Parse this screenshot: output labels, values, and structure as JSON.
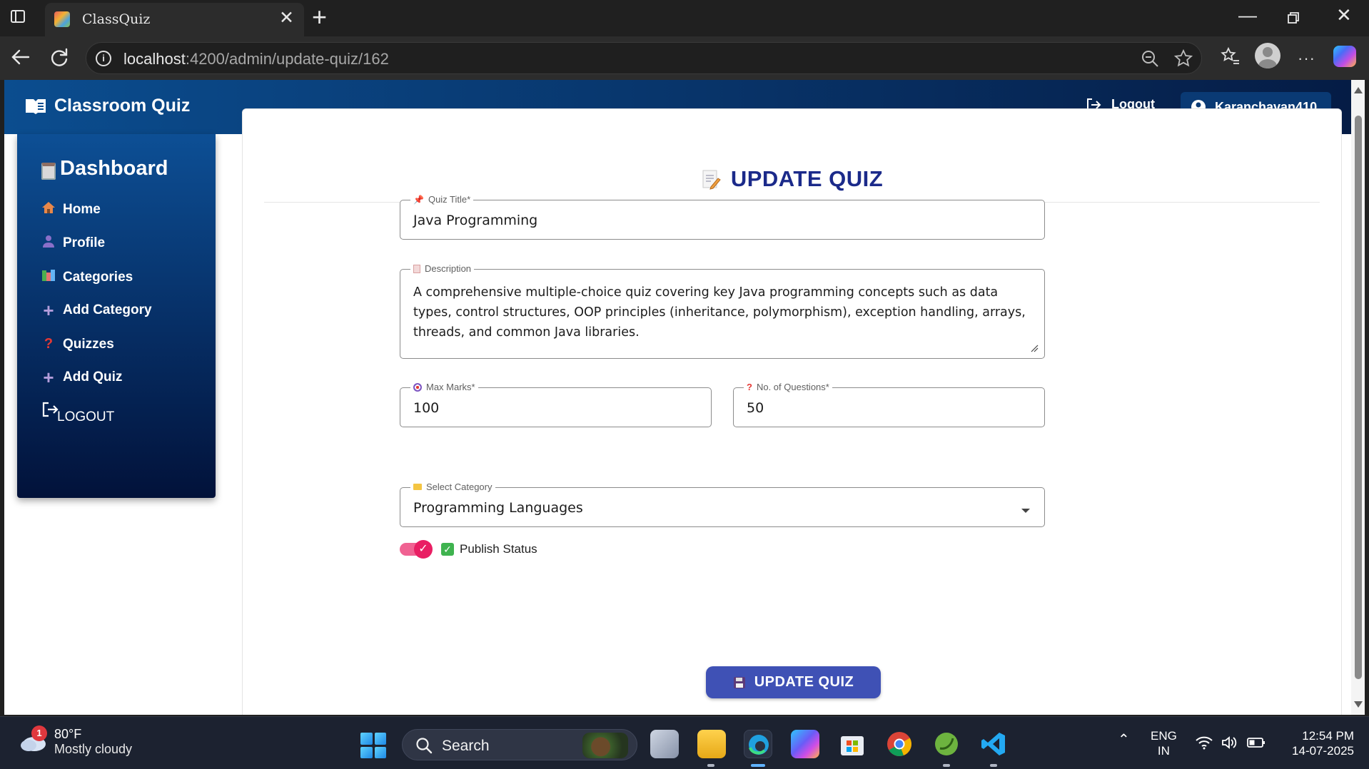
{
  "browser": {
    "tab_title": "ClassQuiz",
    "url_host": "localhost",
    "url_path": ":4200/admin/update-quiz/162"
  },
  "header": {
    "brand": "Classroom Quiz",
    "logout_label": "Logout",
    "username": "Karanchavan410"
  },
  "sidebar": {
    "title": "Dashboard",
    "items": [
      {
        "label": "Home",
        "icon": "house-icon"
      },
      {
        "label": "Profile",
        "icon": "person-icon"
      },
      {
        "label": "Categories",
        "icon": "books-icon"
      },
      {
        "label": "Add Category",
        "icon": "plus-icon"
      },
      {
        "label": "Quizzes",
        "icon": "question-mark-icon"
      },
      {
        "label": "Add Quiz",
        "icon": "plus-icon"
      },
      {
        "label": "LOGOUT",
        "icon": "logout-icon"
      }
    ]
  },
  "form": {
    "heading": "UPDATE QUIZ",
    "title_label": "Quiz Title*",
    "title_value": "Java Programming",
    "description_label": "Description",
    "description_value": "A comprehensive multiple-choice quiz covering key Java programming concepts such as data types, control structures, OOP principles (inheritance, polymorphism), exception handling, arrays, threads, and common Java libraries.",
    "max_marks_label": "Max Marks*",
    "max_marks_value": "100",
    "questions_label": "No. of Questions*",
    "questions_value": "50",
    "publish_label": "Publish Status",
    "publish_on": true,
    "category_label": "Select Category",
    "category_value": "Programming Languages",
    "submit_label": "UPDATE QUIZ"
  },
  "taskbar": {
    "weather_temp": "80°F",
    "weather_condition": "Mostly cloudy",
    "weather_badge": "1",
    "search_label": "Search",
    "lang_line1": "ENG",
    "lang_line2": "IN",
    "time": "12:54 PM",
    "date": "14-07-2025"
  },
  "colors": {
    "header_start": "#0b4d8f",
    "header_end": "#051c45",
    "heading": "#1b2a8a",
    "button": "#3f51b5",
    "toggle": "#e91e63"
  }
}
